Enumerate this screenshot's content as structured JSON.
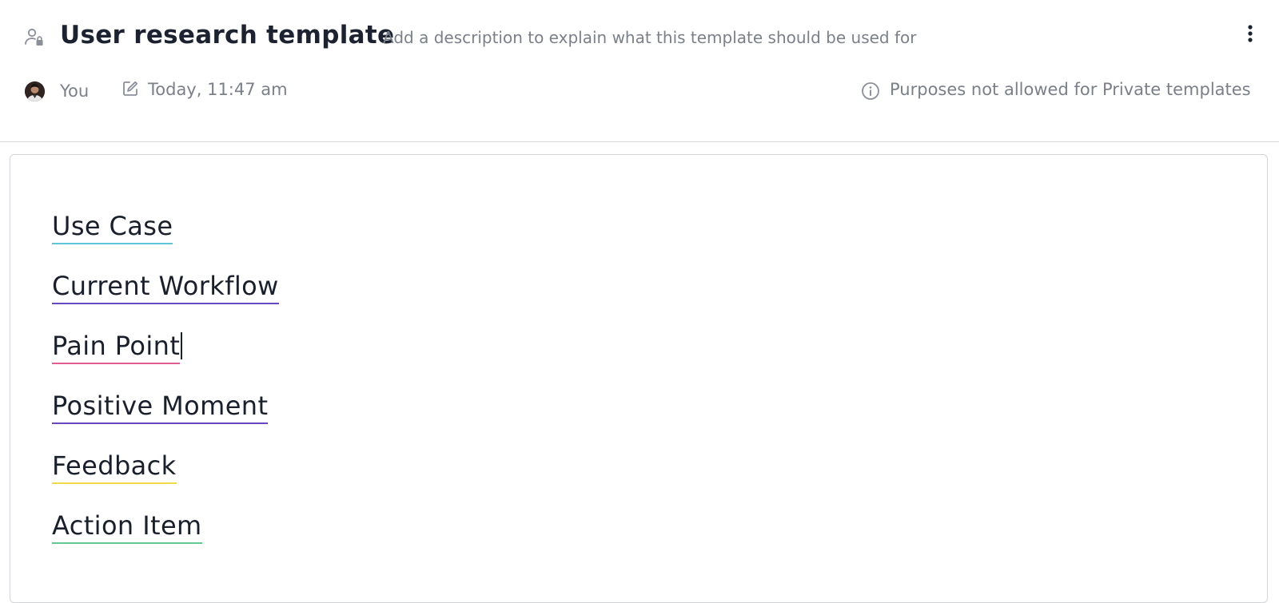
{
  "header": {
    "title": "User research template",
    "description_placeholder": "Add a description to explain what this template should be used for",
    "author": "You",
    "edited": "Today, 11:47 am",
    "purposes_note": "Purposes not allowed for Private templates",
    "icons": {
      "privacy": "private-user-lock-icon",
      "edit": "edit-icon",
      "info": "info-icon",
      "more": "more-vertical-icon"
    }
  },
  "editor": {
    "tags": [
      {
        "label": "Use Case",
        "color": "#5ec6d8"
      },
      {
        "label": "Current Workflow",
        "color": "#6b46c1"
      },
      {
        "label": "Pain Point",
        "color": "#e05d93"
      },
      {
        "label": "Positive Moment",
        "color": "#6b46c1"
      },
      {
        "label": "Feedback",
        "color": "#f0d94a"
      },
      {
        "label": "Action Item",
        "color": "#62c993"
      }
    ]
  }
}
